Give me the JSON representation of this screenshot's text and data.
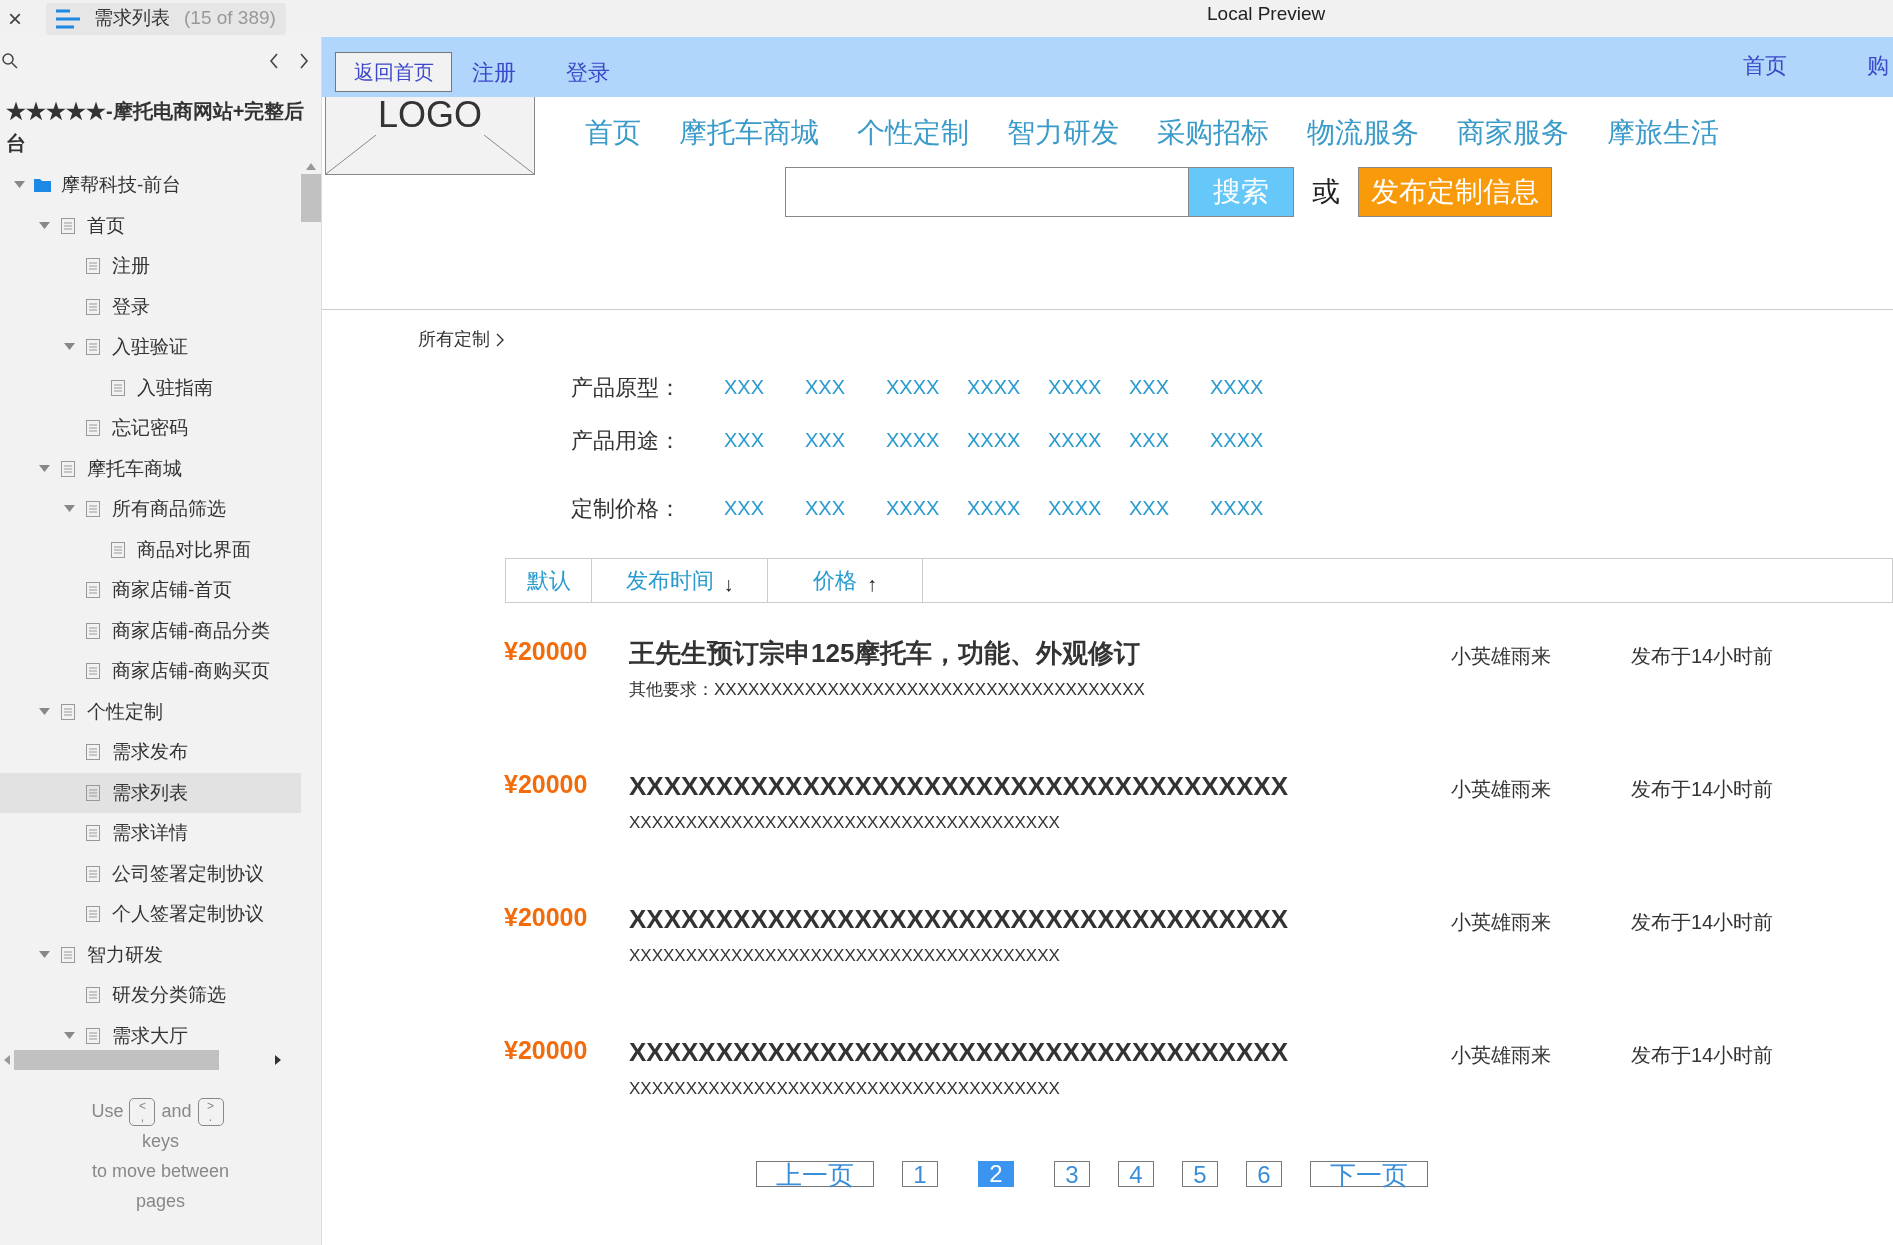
{
  "titlebar": {
    "close": "×",
    "tab_title": "需求列表",
    "tab_count": "(15 of 389)",
    "title": "Local Preview"
  },
  "sidebar": {
    "project": "★★★★★-摩托电商网站+完整后台",
    "tree": [
      {
        "label": "摩帮科技-前台",
        "kind": "folder",
        "expanded": true,
        "selected": false,
        "children": [
          {
            "label": "首页",
            "kind": "page",
            "expanded": true,
            "selected": false,
            "children": [
              {
                "label": "注册",
                "kind": "page",
                "selected": false
              },
              {
                "label": "登录",
                "kind": "page",
                "selected": false
              },
              {
                "label": "入驻验证",
                "kind": "page",
                "expanded": true,
                "selected": false,
                "children": [
                  {
                    "label": "入驻指南",
                    "kind": "page",
                    "selected": false
                  }
                ]
              },
              {
                "label": "忘记密码",
                "kind": "page",
                "selected": false
              }
            ]
          },
          {
            "label": "摩托车商城",
            "kind": "page",
            "expanded": true,
            "selected": false,
            "children": [
              {
                "label": "所有商品筛选",
                "kind": "page",
                "expanded": true,
                "selected": false,
                "children": [
                  {
                    "label": "商品对比界面",
                    "kind": "page",
                    "selected": false
                  }
                ]
              },
              {
                "label": "商家店铺-首页",
                "kind": "page",
                "selected": false
              },
              {
                "label": "商家店铺-商品分类",
                "kind": "page",
                "selected": false
              },
              {
                "label": "商家店铺-商购买页",
                "kind": "page",
                "selected": false
              }
            ]
          },
          {
            "label": "个性定制",
            "kind": "page",
            "expanded": true,
            "selected": false,
            "children": [
              {
                "label": "需求发布",
                "kind": "page",
                "selected": false
              },
              {
                "label": "需求列表",
                "kind": "page",
                "selected": true
              },
              {
                "label": "需求详情",
                "kind": "page",
                "selected": false
              },
              {
                "label": "公司签署定制协议",
                "kind": "page",
                "selected": false
              },
              {
                "label": "个人签署定制协议",
                "kind": "page",
                "selected": false
              }
            ]
          },
          {
            "label": "智力研发",
            "kind": "page",
            "expanded": true,
            "selected": false,
            "children": [
              {
                "label": "研发分类筛选",
                "kind": "page",
                "selected": false
              },
              {
                "label": "需求大厅",
                "kind": "page",
                "expanded": true,
                "selected": false
              }
            ]
          }
        ]
      }
    ],
    "hint": {
      "use": "Use",
      "key_prev": [
        "<",
        ","
      ],
      "and": "and",
      "key_next": [
        ">",
        "."
      ],
      "rest": "keys\nto move between\npages"
    }
  },
  "topbar": {
    "back": "返回首页",
    "links": [
      "注册",
      "登录"
    ],
    "right_links": [
      "首页",
      "购"
    ]
  },
  "logo": "LOGO",
  "nav": [
    "首页",
    "摩托车商城",
    "个性定制",
    "智力研发",
    "采购招标",
    "物流服务",
    "商家服务",
    "摩旅生活"
  ],
  "search": {
    "button": "搜索",
    "or": "或",
    "publish": "发布定制信息"
  },
  "breadcrumb": "所有定制",
  "filters": [
    {
      "label": "产品原型：",
      "options": [
        "XXX",
        "XXX",
        "XXXX",
        "XXXX",
        "XXXX",
        "XXX",
        "XXXX"
      ]
    },
    {
      "label": "产品用途：",
      "options": [
        "XXX",
        "XXX",
        "XXXX",
        "XXXX",
        "XXXX",
        "XXX",
        "XXXX"
      ]
    },
    {
      "label": "定制价格：",
      "options": [
        "XXX",
        "XXX",
        "XXXX",
        "XXXX",
        "XXXX",
        "XXX",
        "XXXX"
      ]
    }
  ],
  "sort": [
    {
      "label": "默认"
    },
    {
      "label": "发布时间",
      "arrow": "↓"
    },
    {
      "label": "价格",
      "arrow": "↑"
    }
  ],
  "listings": [
    {
      "price": "¥20000",
      "title": "王先生预订宗申125摩托车，功能、外观修订",
      "detail": "其他要求：XXXXXXXXXXXXXXXXXXXXXXXXXXXXXXXXXXXXXX",
      "author": "小英雄雨来",
      "time": "发布于14小时前"
    },
    {
      "price": "¥20000",
      "title": "XXXXXXXXXXXXXXXXXXXXXXXXXXXXXXXXXXXXXX",
      "detail": "XXXXXXXXXXXXXXXXXXXXXXXXXXXXXXXXXXXXXX",
      "author": "小英雄雨来",
      "time": "发布于14小时前"
    },
    {
      "price": "¥20000",
      "title": "XXXXXXXXXXXXXXXXXXXXXXXXXXXXXXXXXXXXXX",
      "detail": "XXXXXXXXXXXXXXXXXXXXXXXXXXXXXXXXXXXXXX",
      "author": "小英雄雨来",
      "time": "发布于14小时前"
    },
    {
      "price": "¥20000",
      "title": "XXXXXXXXXXXXXXXXXXXXXXXXXXXXXXXXXXXXXX",
      "detail": "XXXXXXXXXXXXXXXXXXXXXXXXXXXXXXXXXXXXXX",
      "author": "小英雄雨来",
      "time": "发布于14小时前"
    }
  ],
  "pagination": {
    "prev": "上一页",
    "pages": [
      {
        "label": "1",
        "selected": false
      },
      {
        "label": "2",
        "selected": true
      },
      {
        "label": "3",
        "selected": false
      },
      {
        "label": "4",
        "selected": false
      },
      {
        "label": "5",
        "selected": false
      },
      {
        "label": "6",
        "selected": false
      }
    ],
    "next": "下一页"
  }
}
